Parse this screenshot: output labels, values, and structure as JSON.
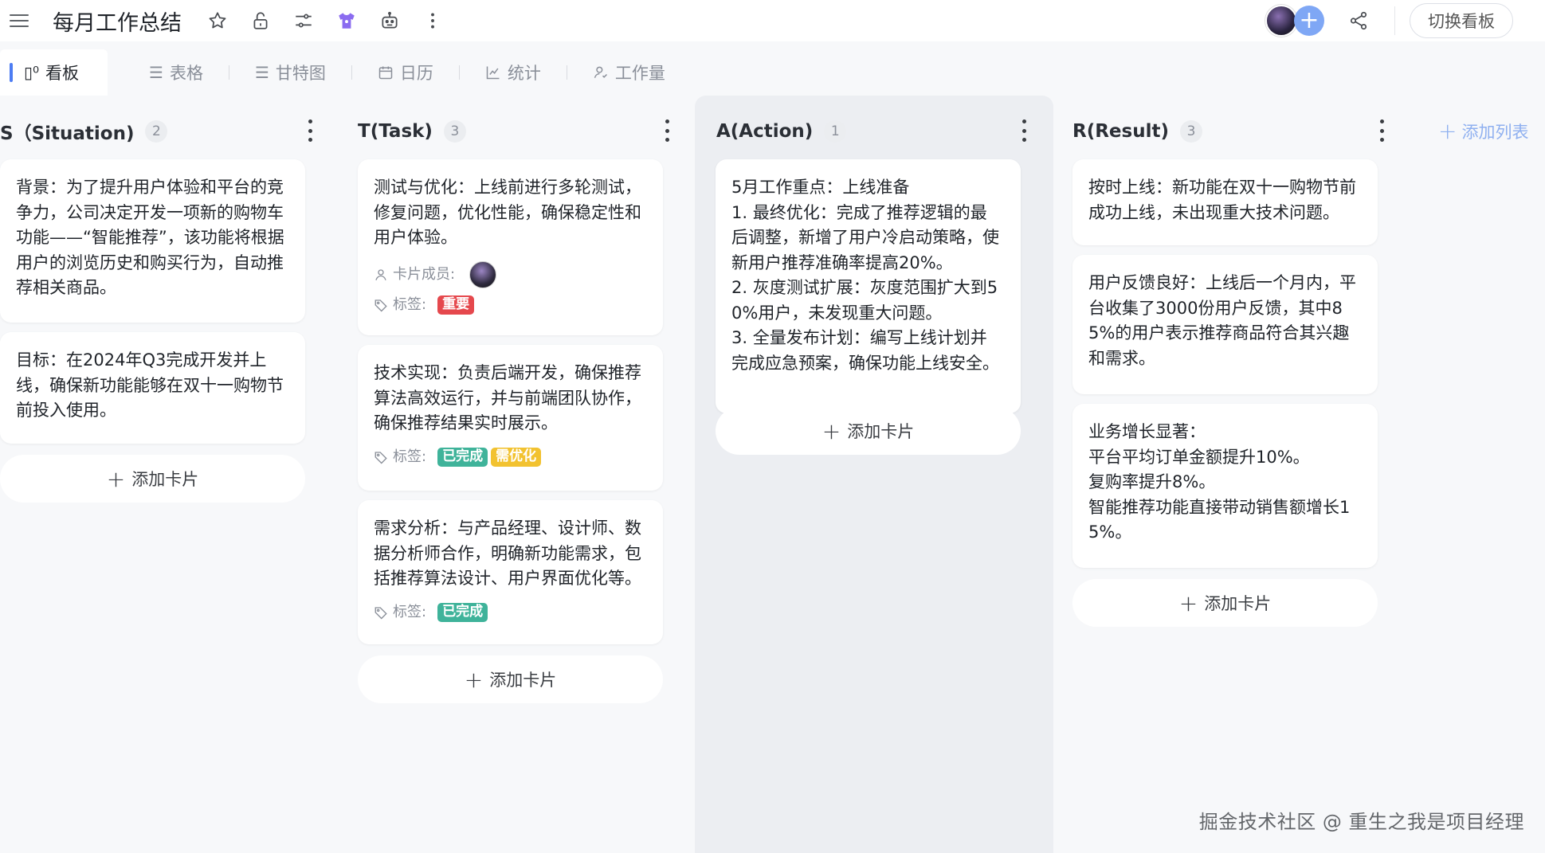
{
  "header": {
    "title": "每月工作总结",
    "switch_label": "切换看板",
    "icons": [
      "menu-icon",
      "star-icon",
      "lock-icon",
      "filter-sliders-icon",
      "theme-shirt-icon",
      "robot-icon",
      "more-vertical-icon"
    ]
  },
  "tabs": [
    {
      "label": "看板",
      "icon": "board-icon"
    },
    {
      "label": "表格",
      "icon": "list-icon"
    },
    {
      "label": "甘特图",
      "icon": "gantt-icon"
    },
    {
      "label": "日历",
      "icon": "calendar-icon"
    },
    {
      "label": "统计",
      "icon": "chart-icon"
    },
    {
      "label": "工作量",
      "icon": "workload-icon"
    }
  ],
  "columns": [
    {
      "title": "S（Situation)",
      "count": "2",
      "cards": [
        {
          "text": "背景：为了提升用户体验和平台的竞争力，公司决定开发一项新的购物车功能——“智能推荐”，该功能将根据用户的浏览历史和购买行为，自动推荐相关商品。"
        },
        {
          "text": "目标：在2024年Q3完成开发并上线，确保新功能能够在双十一购物节前投入使用。"
        }
      ]
    },
    {
      "title": "T(Task)",
      "count": "3",
      "cards": [
        {
          "text": "测试与优化：上线前进行多轮测试，修复问题，优化性能，确保稳定性和用户体验。",
          "members_label": "卡片成员:",
          "tags_label": "标签:",
          "tags": [
            "重要"
          ]
        },
        {
          "text": "技术实现：负责后端开发，确保推荐算法高效运行，并与前端团队协作，确保推荐结果实时展示。",
          "tags_label": "标签:",
          "tags": [
            "已完成",
            "需优化"
          ]
        },
        {
          "text": "需求分析：与产品经理、设计师、数据分析师合作，明确新功能需求，包括推荐算法设计、用户界面优化等。",
          "tags_label": "标签:",
          "tags": [
            "已完成"
          ]
        }
      ]
    },
    {
      "title": "A(Action)",
      "count": "1",
      "cards": [
        {
          "text": "5月工作重点：上线准备\n1. 最终优化：完成了推荐逻辑的最后调整，新增了用户冷启动策略，使新用户推荐准确率提高20%。\n2. 灰度测试扩展：灰度范围扩大到50%用户，未发现重大问题。\n3. 全量发布计划：编写上线计划并完成应急预案，确保功能上线安全。"
        }
      ]
    },
    {
      "title": "R(Result)",
      "count": "3",
      "cards": [
        {
          "text": "按时上线：新功能在双十一购物节前成功上线，未出现重大技术问题。"
        },
        {
          "text": "用户反馈良好：上线后一个月内，平台收集了3000份用户反馈，其中85%的用户表示推荐商品符合其兴趣和需求。"
        },
        {
          "text": "业务增长显著：\n平台平均订单金额提升10%。\n复购率提升8%。\n智能推荐功能直接带动销售额增长15%。"
        }
      ]
    }
  ],
  "add_card_label": "添加卡片",
  "add_list_label": "添加列表",
  "tag_colors": {
    "重要": "#e5484d",
    "已完成": "#3fb39a",
    "需优化": "#f2c230"
  },
  "accent": "#4c7cf3",
  "watermark": "掘金技术社区 @ 重生之我是项目经理"
}
